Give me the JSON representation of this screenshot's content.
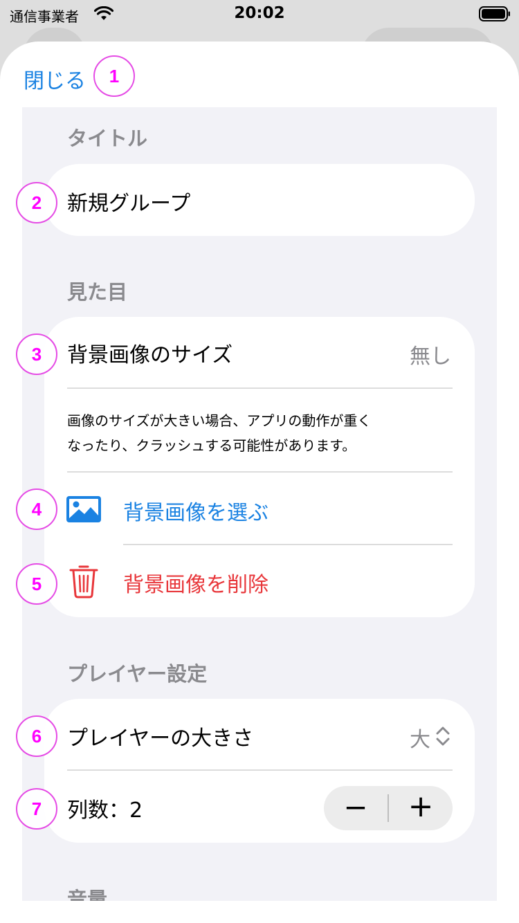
{
  "status_bar": {
    "carrier": "通信事業者",
    "time": "20:02"
  },
  "header": {
    "close_label": "閉じる"
  },
  "sections": {
    "title": {
      "heading": "タイトル",
      "value": "新規グループ"
    },
    "appearance": {
      "heading": "見た目",
      "bg_size_label": "背景画像のサイズ",
      "bg_size_value": "無し",
      "note_line1": "画像のサイズが大きい場合、アプリの動作が重く",
      "note_line2": "なったり、クラッシュする可能性があります。",
      "choose_label": "背景画像を選ぶ",
      "delete_label": "背景画像を削除"
    },
    "player": {
      "heading": "プレイヤー設定",
      "size_label": "プレイヤーの大きさ",
      "size_value": "大",
      "columns_label": "列数：2",
      "minus": "−",
      "plus": "+"
    },
    "volume": {
      "heading": "音量"
    }
  },
  "markers": [
    "1",
    "2",
    "3",
    "4",
    "5",
    "6",
    "7"
  ],
  "colors": {
    "accent": "#1a82e2",
    "destructive": "#e8363a",
    "secondary_text": "#8a8a8e",
    "grouped_bg": "#f2f2f7",
    "marker": "#ff00ff"
  },
  "icons": {
    "wifi": "wifi-icon",
    "battery": "battery-icon",
    "photo": "photo-icon",
    "trash": "trash-icon",
    "chevron": "chevron-up-down-icon"
  }
}
